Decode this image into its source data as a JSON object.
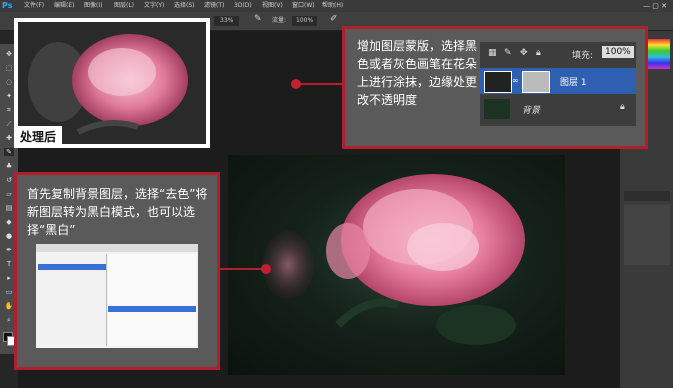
{
  "app": {
    "logo": "Ps"
  },
  "menu": [
    "文件(F)",
    "编辑(E)",
    "图像(I)",
    "图层(L)",
    "文字(Y)",
    "选择(S)",
    "滤镜(T)",
    "3D(D)",
    "视图(V)",
    "窗口(W)",
    "帮助(H)"
  ],
  "window_controls": "—  ▢  ✕",
  "options": {
    "zoom": "33%",
    "flow_label": "流量:",
    "flow_value": "100%"
  },
  "after_label": "处理后",
  "callout_top": {
    "text": "增加图层蒙版，选择黑色或者灰色画笔在花朵上进行涂抹，边缘处更改不透明度"
  },
  "callout_left": {
    "text": "首先复制背景图层，选择“去色”将新图层转为黑白模式，也可以选择“黑白”"
  },
  "layers": {
    "fill_label": "填充:",
    "fill_value": "100%",
    "rows": [
      {
        "name": "图层 1"
      },
      {
        "name": "背景"
      }
    ]
  },
  "colors": {
    "callout_border": "#b11f2b",
    "panel": "#3a3a3a",
    "selection": "#2f5fb0"
  }
}
